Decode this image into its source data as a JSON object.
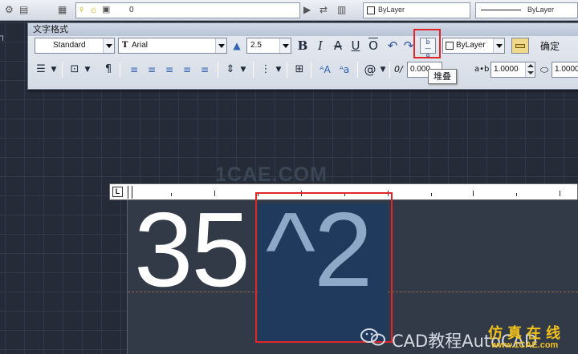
{
  "top_strip": {
    "layer_value": "0",
    "linetype_left": "ByLayer",
    "linetype_right": "ByLayer"
  },
  "toolbar": {
    "title": "文字格式",
    "style": "Standard",
    "font": "Arial",
    "font_prefix": "T",
    "height": "2.5",
    "bold": "B",
    "italic": "I",
    "strike": "A",
    "underline": "U",
    "overline": "O",
    "undo": "↶",
    "redo": "↷",
    "stack_icon": "stack-icon",
    "color": "ByLayer",
    "ruler_icon": "ruler-icon",
    "ok": "确定",
    "oblique_value": "0.000",
    "tracking_prefix": "a•b",
    "tracking_value": "1.0000",
    "width_value": "1.0000",
    "at_symbol": "@",
    "oblique_symbol": "0/",
    "tooltip": "堆叠"
  },
  "editor": {
    "text_plain": "35",
    "text_selected": "^2",
    "ruler_corner": "L"
  },
  "watermark": "1CAE.COM",
  "brand": {
    "text": "CAD教程AutoCAD",
    "cn": "仿真在线",
    "url": "www.1CAE.com"
  }
}
